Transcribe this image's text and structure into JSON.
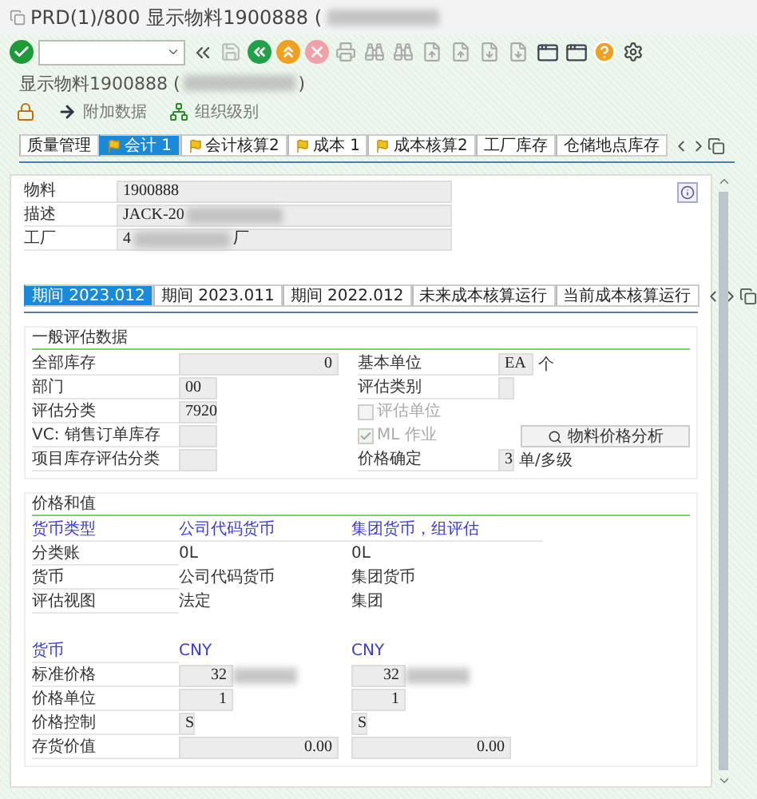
{
  "window": {
    "title": "PRD(1)/800 显示物料1900888 (",
    "title_redacted": true
  },
  "heading": {
    "text": "显示物料1900888 (",
    "redacted": true,
    "tail": ")"
  },
  "app_toolbar": [
    {
      "kind": "lock"
    },
    {
      "kind": "arrow",
      "label": "附加数据"
    },
    {
      "kind": "org",
      "label": "组织级别"
    }
  ],
  "tabs": [
    {
      "label": "质量管理",
      "selected": false,
      "flagged": false
    },
    {
      "label": "会计 1",
      "selected": true,
      "flagged": true
    },
    {
      "label": "会计核算2",
      "selected": false,
      "flagged": true
    },
    {
      "label": "成本 1",
      "selected": false,
      "flagged": true
    },
    {
      "label": "成本核算2",
      "selected": false,
      "flagged": true
    },
    {
      "label": "工厂库存",
      "selected": false,
      "flagged": false
    },
    {
      "label": "仓储地点库存",
      "selected": false,
      "flagged": false
    }
  ],
  "header_fields": [
    {
      "label": "物料",
      "value": "1900888",
      "redacted": false
    },
    {
      "label": "描述",
      "value": "JACK-20",
      "redacted": true
    },
    {
      "label": "工厂",
      "value": "4",
      "redacted": true,
      "suffix": "厂"
    }
  ],
  "period_tabs": [
    {
      "label": "期间 2023.012",
      "selected": true
    },
    {
      "label": "期间 2023.011",
      "selected": false
    },
    {
      "label": "期间 2022.012",
      "selected": false
    },
    {
      "label": "未来成本核算运行",
      "selected": false
    },
    {
      "label": "当前成本核算运行",
      "selected": false
    }
  ],
  "general": {
    "title": "一般评估数据",
    "left": [
      {
        "label": "全部库存",
        "value": "0",
        "kind": "quantity"
      },
      {
        "label": "部门",
        "value": "00",
        "kind": "code"
      },
      {
        "label": "评估分类",
        "value": "7920",
        "kind": "code"
      },
      {
        "label": "VC: 销售订单库存",
        "kind": "code"
      },
      {
        "label": "项目库存评估分类",
        "kind": "code"
      }
    ],
    "right": [
      {
        "kind": "field",
        "label": "基本单位",
        "value": "EA",
        "unit": "个"
      },
      {
        "kind": "field",
        "label": "评估类别"
      },
      {
        "kind": "checkbox",
        "label": "评估单位",
        "checked": false,
        "disabled": true
      },
      {
        "kind": "checkbox",
        "label": "ML 作业",
        "checked": true,
        "disabled": true,
        "button": "物料价格分析"
      },
      {
        "kind": "field",
        "label": "价格确定",
        "value": "3",
        "unit": "单/多级"
      }
    ]
  },
  "prices": {
    "title": "价格和值",
    "header": [
      "货币类型",
      "公司代码货币",
      "集团货币，组评估"
    ],
    "rows": [
      [
        "分类账",
        "0L",
        "0L"
      ],
      [
        "货币",
        "公司代码货币",
        "集团货币"
      ],
      [
        "评估视图",
        "法定",
        "集团"
      ]
    ],
    "currency": [
      "货币",
      "CNY",
      "CNY"
    ],
    "fields": [
      {
        "label": "标准价格",
        "kind": "amount",
        "values": [
          "32",
          "32"
        ],
        "redacted": true
      },
      {
        "label": "价格单位",
        "kind": "short",
        "values": [
          "1",
          "1"
        ],
        "redacted": false
      },
      {
        "label": "价格控制",
        "kind": "char",
        "values": [
          "S",
          "S"
        ],
        "redacted": false
      },
      {
        "label": "存货价值",
        "kind": "wide",
        "values": [
          "0.00",
          "0.00"
        ],
        "redacted": false
      }
    ]
  }
}
